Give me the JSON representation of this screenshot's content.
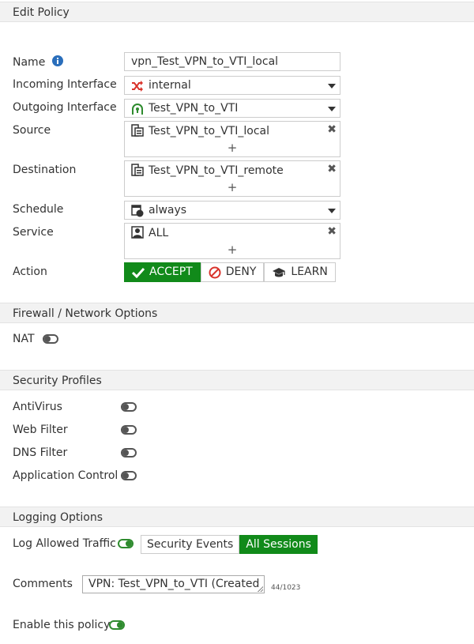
{
  "title": "Edit Policy",
  "fields": {
    "name_label": "Name",
    "name_value": "vpn_Test_VPN_to_VTI_local",
    "incoming_label": "Incoming Interface",
    "incoming_value": "internal",
    "outgoing_label": "Outgoing Interface",
    "outgoing_value": "Test_VPN_to_VTI",
    "source_label": "Source",
    "source_value": "Test_VPN_to_VTI_local",
    "destination_label": "Destination",
    "destination_value": "Test_VPN_to_VTI_remote",
    "schedule_label": "Schedule",
    "schedule_value": "always",
    "service_label": "Service",
    "service_value": "ALL",
    "action_label": "Action",
    "plus": "+",
    "remove": "✖"
  },
  "actions": {
    "accept": "ACCEPT",
    "deny": "DENY",
    "learn": "LEARN",
    "selected": "accept"
  },
  "firewall": {
    "header": "Firewall / Network Options",
    "nat_label": "NAT",
    "nat_enabled": false
  },
  "security": {
    "header": "Security Profiles",
    "antivirus": "AntiVirus",
    "web_filter": "Web Filter",
    "dns_filter": "DNS Filter",
    "app_control": "Application Control"
  },
  "logging": {
    "header": "Logging Options",
    "log_label": "Log Allowed Traffic",
    "log_enabled": true,
    "security_events": "Security Events",
    "all_sessions": "All Sessions",
    "selected": "all_sessions"
  },
  "comments": {
    "label": "Comments",
    "value": "VPN: Test_VPN_to_VTI (Created",
    "counter": "44/1023"
  },
  "enable": {
    "label": "Enable this policy",
    "enabled": true
  },
  "colors": {
    "accent_green": "#118a1a",
    "info_blue": "#2a6ebb",
    "interface_red": "#d9332b",
    "vpn_green": "#2e8b2e"
  },
  "icons": {
    "info": "info-icon",
    "incoming": "shuffle-icon",
    "outgoing": "vpn-tunnel-icon",
    "address": "address-group-icon",
    "schedule": "calendar-clock-icon",
    "service": "service-icon",
    "accept": "check-icon",
    "deny": "ban-icon",
    "learn": "graduation-cap-icon"
  }
}
